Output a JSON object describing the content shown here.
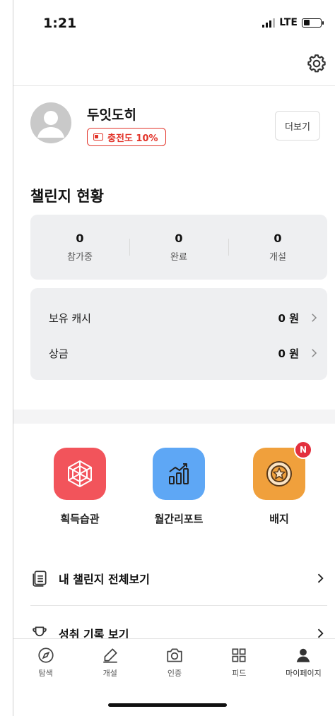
{
  "status_bar": {
    "time": "1:21",
    "network": "LTE"
  },
  "profile": {
    "name": "두잇도히",
    "charge_label": "충전도 10%",
    "more_button": "더보기"
  },
  "challenge": {
    "title": "챌린지 현황",
    "stats": [
      {
        "value": "0",
        "label": "참가중"
      },
      {
        "value": "0",
        "label": "완료"
      },
      {
        "value": "0",
        "label": "개설"
      }
    ]
  },
  "wallet": {
    "rows": [
      {
        "label": "보유 캐시",
        "amount": "0 원"
      },
      {
        "label": "상금",
        "amount": "0 원"
      }
    ]
  },
  "tiles": [
    {
      "label": "획득습관",
      "color": "#f2545b"
    },
    {
      "label": "월간리포트",
      "color": "#5ea7f5"
    },
    {
      "label": "배지",
      "color": "#f0a03c",
      "badge": "N"
    }
  ],
  "menu": [
    {
      "label": "내 챌린지 전체보기"
    },
    {
      "label": "성취 기록 보기"
    }
  ],
  "tabbar": [
    {
      "label": "탐색",
      "icon": "compass-icon"
    },
    {
      "label": "개설",
      "icon": "pencil-icon"
    },
    {
      "label": "인증",
      "icon": "camera-icon"
    },
    {
      "label": "피드",
      "icon": "grid-icon"
    },
    {
      "label": "마이페이지",
      "icon": "person-icon",
      "active": true
    }
  ]
}
